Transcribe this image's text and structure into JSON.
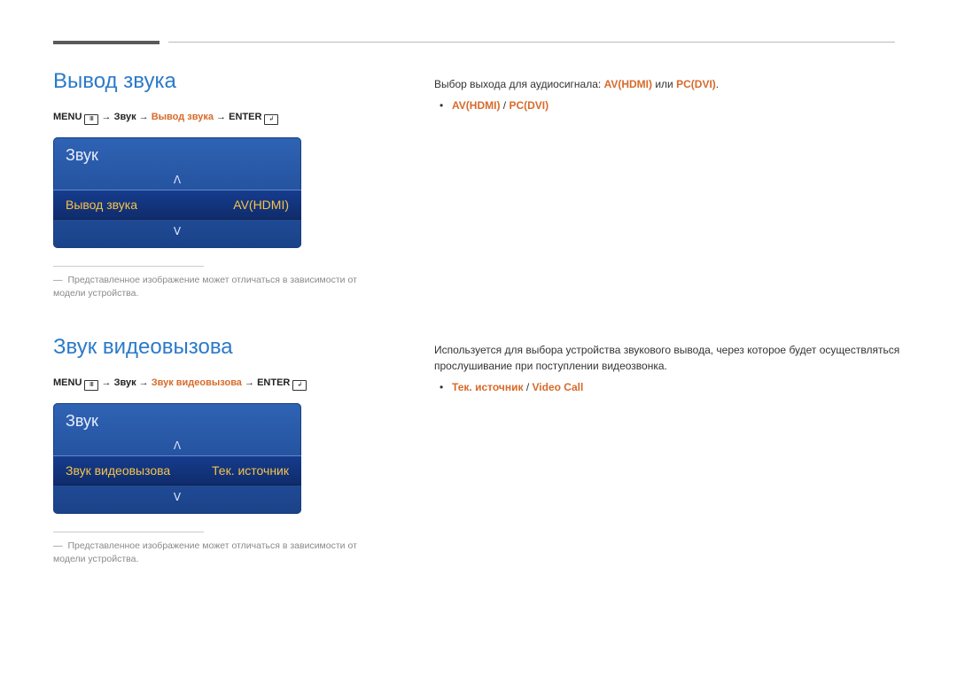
{
  "section1": {
    "title": "Вывод звука",
    "nav": {
      "menu": "MENU",
      "path1": "Звук",
      "path2": "Вывод звука",
      "enter": "ENTER",
      "arrow": "→"
    },
    "osd": {
      "header": "Звук",
      "up": "ᐱ",
      "down": "ᐯ",
      "item_label": "Вывод звука",
      "item_value": "AV(HDMI)"
    },
    "footnote": "Представленное изображение может отличаться в зависимости от модели устройства.",
    "desc_prefix": "Выбор выхода для аудиосигнала:",
    "opt1": "AV(HDMI)",
    "mid": "или",
    "opt2": "PC(DVI)",
    "bullet_a": "AV(HDMI)",
    "bullet_sep": "/",
    "bullet_b": "PC(DVI)"
  },
  "section2": {
    "title": "Звук видеовызова",
    "nav": {
      "menu": "MENU",
      "path1": "Звук",
      "path2": "Звук видеовызова",
      "enter": "ENTER",
      "arrow": "→"
    },
    "osd": {
      "header": "Звук",
      "up": "ᐱ",
      "down": "ᐯ",
      "item_label": "Звук видеовызова",
      "item_value": "Тек. источник"
    },
    "footnote": "Представленное изображение может отличаться в зависимости от модели устройства.",
    "desc": "Используется для выбора устройства звукового вывода, через которое будет осуществляться прослушивание при поступлении видеозвонка.",
    "bullet_a": "Тек. источник",
    "bullet_sep": "/",
    "bullet_b": "Video Call"
  },
  "icons": {
    "menu_glyph": "Ⅲ",
    "enter_glyph": "↲"
  }
}
